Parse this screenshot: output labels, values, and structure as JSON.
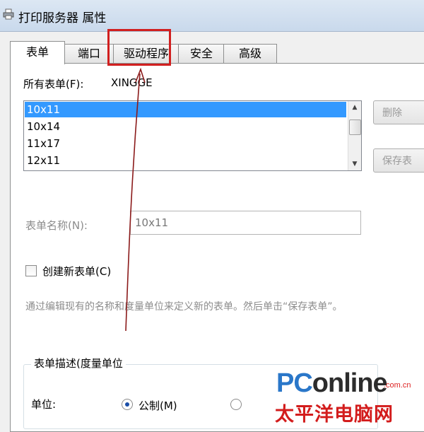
{
  "window": {
    "title": "打印服务器 属性",
    "icon": "printer-icon"
  },
  "tabs": [
    {
      "label": "表单",
      "active": true
    },
    {
      "label": "端口",
      "active": false
    },
    {
      "label": "驱动程序",
      "active": false,
      "highlighted": true
    },
    {
      "label": "安全",
      "active": false
    },
    {
      "label": "高级",
      "active": false
    }
  ],
  "forms_on": {
    "label": "所有表单(F):",
    "value": "XINGGE"
  },
  "form_list": {
    "items": [
      "10x11",
      "10x14",
      "11x17",
      "12x11"
    ],
    "selected": "10x11"
  },
  "buttons": {
    "delete": "删除",
    "save": "保存表"
  },
  "form_name": {
    "label": "表单名称(N):",
    "value": "10x11"
  },
  "create_new": {
    "label": "创建新表单(C)",
    "checked": false
  },
  "description": "通过编辑现有的名称和度量单位来定义新的表单。然后单击“保存表单”。",
  "form_desc_group": {
    "title": "表单描述(度量单位",
    "unit_label": "单位:",
    "metric_label": "公制(M)",
    "metric_selected": true
  },
  "watermark": {
    "brand_a": "PC",
    "brand_b": "online",
    "domain": ".com.cn",
    "cn": "太平洋电脑网"
  },
  "colors": {
    "highlight": "#d11f1f",
    "arrow": "#8b1a1a",
    "selection": "#3399ff"
  }
}
